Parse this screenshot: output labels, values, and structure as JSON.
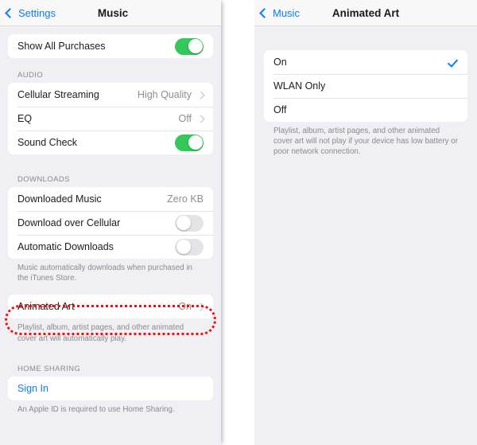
{
  "left_panel": {
    "navbar": {
      "back_label": "Settings",
      "back_icon": "chevron-left-icon",
      "title": "Music"
    },
    "top_group": {
      "rows": [
        {
          "label": "Show All Purchases",
          "control": "toggle",
          "state": "on"
        }
      ]
    },
    "audio_section": {
      "header": "AUDIO",
      "rows": [
        {
          "label": "Cellular Streaming",
          "value": "High Quality",
          "control": "chevron"
        },
        {
          "label": "EQ",
          "value": "Off",
          "control": "chevron"
        },
        {
          "label": "Sound Check",
          "control": "toggle",
          "state": "on"
        }
      ]
    },
    "downloads_section": {
      "header": "DOWNLOADS",
      "rows": [
        {
          "label": "Downloaded Music",
          "value": "Zero KB",
          "control": "none"
        },
        {
          "label": "Download over Cellular",
          "control": "toggle",
          "state": "off"
        },
        {
          "label": "Automatic Downloads",
          "control": "toggle",
          "state": "off"
        }
      ],
      "footer": "Music automatically downloads when purchased in the iTunes Store."
    },
    "animated_art_section": {
      "rows": [
        {
          "label": "Animated Art",
          "value": "On",
          "control": "chevron",
          "highlighted": true
        }
      ],
      "footer": "Playlist, album, artist pages, and other animated cover art will automatically play."
    },
    "home_sharing_section": {
      "header": "HOME SHARING",
      "rows": [
        {
          "label": "Sign In",
          "control": "link"
        }
      ],
      "footer": "An Apple ID is required to use Home Sharing."
    }
  },
  "right_panel": {
    "navbar": {
      "back_label": "Music",
      "back_icon": "chevron-left-icon",
      "title": "Animated Art"
    },
    "options_group": {
      "options": [
        {
          "label": "On",
          "selected": true,
          "highlighted": true
        },
        {
          "label": "WLAN Only",
          "selected": false
        },
        {
          "label": "Off",
          "selected": false
        }
      ],
      "footer": "Playlist, album, artist pages, and other animated cover art will not play if your device has low battery or poor network connection."
    }
  },
  "colors": {
    "accent_blue": "#0a7cff",
    "toggle_on_green": "#34c759",
    "highlight_red": "#ee1111",
    "background_gray": "#efeff4",
    "secondary_text": "#8e8e93"
  }
}
